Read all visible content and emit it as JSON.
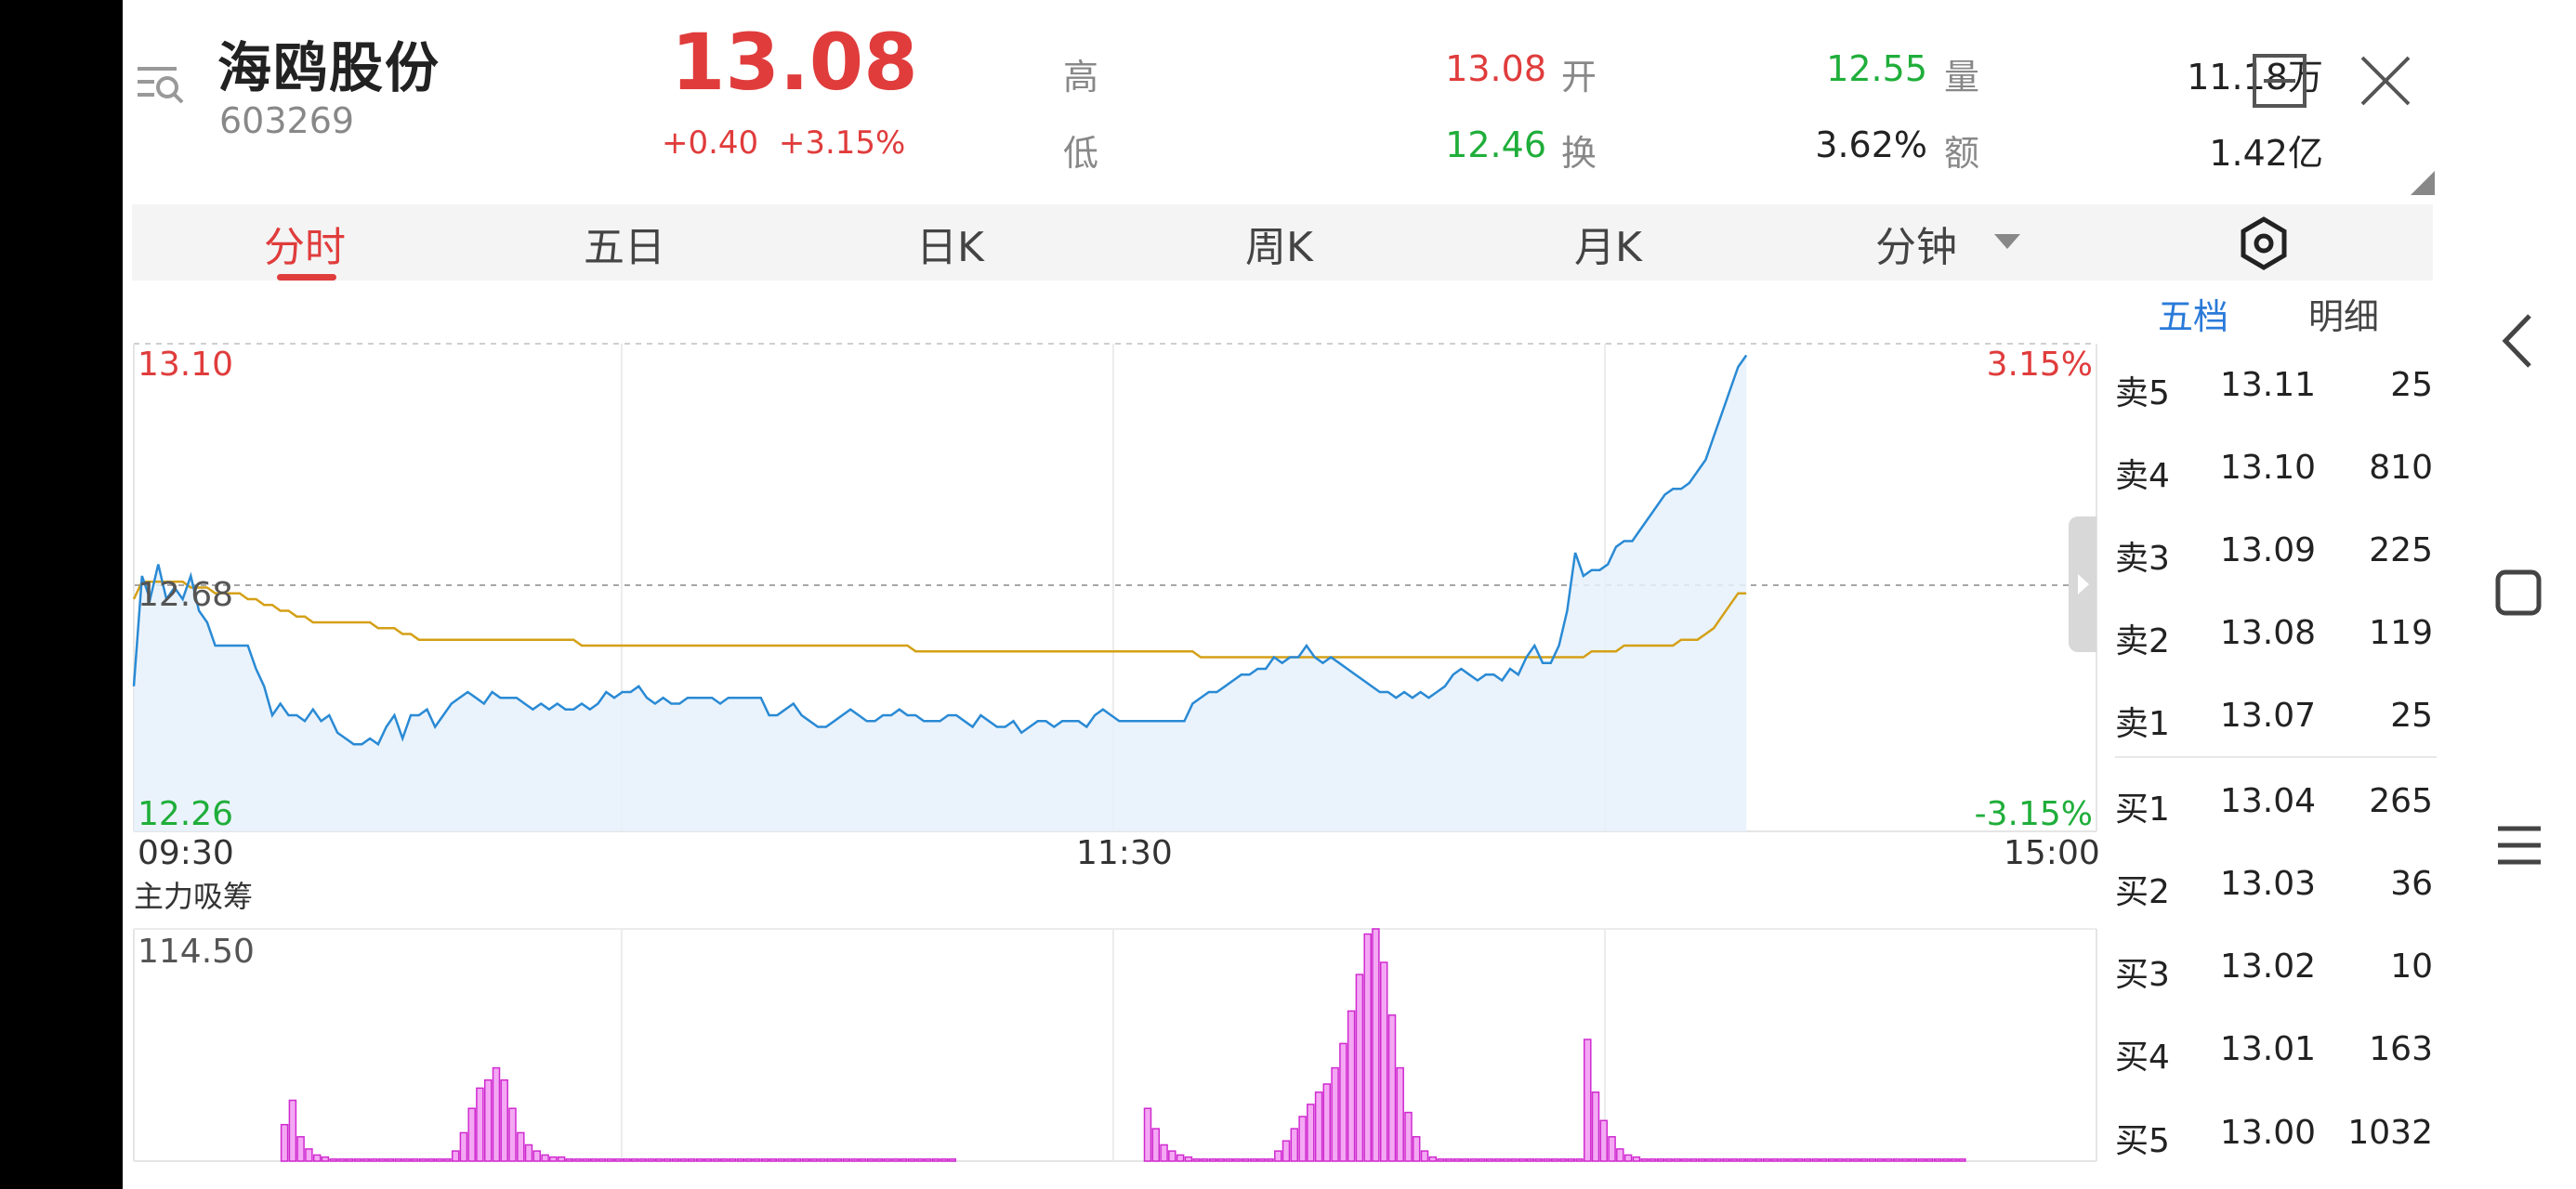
{
  "stock": {
    "name": "海鸥股份",
    "code": "603269",
    "price": "13.08",
    "change": "+0.40",
    "change_pct": "+3.15%"
  },
  "stats": {
    "high_label": "高",
    "high": "13.08",
    "open_label": "开",
    "open": "12.55",
    "volume_label": "量",
    "volume": "11.18万",
    "low_label": "低",
    "low": "12.46",
    "turnover_label": "换",
    "turnover": "3.62%",
    "amount_label": "额",
    "amount": "1.42亿"
  },
  "tabs": [
    "分时",
    "五日",
    "日K",
    "周K",
    "月K",
    "分钟"
  ],
  "active_tab": "分时",
  "orderbook": {
    "tabs": [
      "五档",
      "明细"
    ],
    "asks": [
      {
        "label": "卖5",
        "price": "13.11",
        "volume": "25"
      },
      {
        "label": "卖4",
        "price": "13.10",
        "volume": "810"
      },
      {
        "label": "卖3",
        "price": "13.09",
        "volume": "225"
      },
      {
        "label": "卖2",
        "price": "13.08",
        "volume": "119"
      },
      {
        "label": "卖1",
        "price": "13.07",
        "volume": "25"
      }
    ],
    "bids": [
      {
        "label": "买1",
        "price": "13.04",
        "volume": "265"
      },
      {
        "label": "买2",
        "price": "13.03",
        "volume": "36"
      },
      {
        "label": "买3",
        "price": "13.02",
        "volume": "10"
      },
      {
        "label": "买4",
        "price": "13.01",
        "volume": "163"
      },
      {
        "label": "买5",
        "price": "13.00",
        "volume": "1032"
      }
    ]
  },
  "chart_data": [
    {
      "type": "line",
      "y_top_label": "13.10",
      "y_mid_label": "12.68",
      "y_bottom_label": "12.26",
      "pct_top_label": "3.15%",
      "pct_bottom_label": "-3.15%",
      "x_labels": [
        "09:30",
        "11:30",
        "15:00"
      ],
      "ylim": [
        12.26,
        13.1
      ],
      "prev_close": 12.68,
      "series": [
        {
          "values": [
            12.51,
            12.7,
            12.66,
            12.72,
            12.66,
            12.68,
            12.66,
            12.7,
            12.64,
            12.62,
            12.58,
            12.58,
            12.58,
            12.58,
            12.58,
            12.54,
            12.51,
            12.46,
            12.48,
            12.46,
            12.46,
            12.45,
            12.47,
            12.45,
            12.46,
            12.43,
            12.42,
            12.41,
            12.41,
            12.42,
            12.41,
            12.44,
            12.46,
            12.42,
            12.46,
            12.46,
            12.47,
            12.44,
            12.46,
            12.48,
            12.49,
            12.5,
            12.49,
            12.48,
            12.5,
            12.49,
            12.49,
            12.49,
            12.48,
            12.47,
            12.48,
            12.47,
            12.48,
            12.47,
            12.47,
            12.48,
            12.47,
            12.48,
            12.5,
            12.49,
            12.5,
            12.5,
            12.51,
            12.49,
            12.48,
            12.49,
            12.48,
            12.48,
            12.49,
            12.49,
            12.49,
            12.49,
            12.48,
            12.49,
            12.49,
            12.49,
            12.49,
            12.49,
            12.46,
            12.46,
            12.47,
            12.48,
            12.46,
            12.45,
            12.44,
            12.44,
            12.45,
            12.46,
            12.47,
            12.46,
            12.45,
            12.45,
            12.46,
            12.46,
            12.47,
            12.46,
            12.46,
            12.45,
            12.45,
            12.45,
            12.46,
            12.46,
            12.45,
            12.44,
            12.46,
            12.45,
            12.44,
            12.44,
            12.45,
            12.43,
            12.44,
            12.45,
            12.45,
            12.44,
            12.45,
            12.45,
            12.45,
            12.44,
            12.46,
            12.47,
            12.46,
            12.45,
            12.45,
            12.45,
            12.45,
            12.45,
            12.45,
            12.45,
            12.45,
            12.45,
            12.48,
            12.49,
            12.5,
            12.5,
            12.51,
            12.52,
            12.53,
            12.53,
            12.54,
            12.54,
            12.56,
            12.55,
            12.56,
            12.56,
            12.58,
            12.56,
            12.55,
            12.56,
            12.55,
            12.54,
            12.53,
            12.52,
            12.51,
            12.5,
            12.5,
            12.49,
            12.5,
            12.49,
            12.5,
            12.49,
            12.5,
            12.51,
            12.53,
            12.54,
            12.53,
            12.52,
            12.53,
            12.53,
            12.52,
            12.54,
            12.53,
            12.56,
            12.58,
            12.55,
            12.55,
            12.58,
            12.64,
            12.74,
            12.7,
            12.71,
            12.71,
            12.72,
            12.75,
            12.76,
            12.76,
            12.78,
            12.8,
            12.82,
            12.84,
            12.85,
            12.85,
            12.86,
            12.88,
            12.9,
            12.94,
            12.98,
            13.02,
            13.06,
            13.08
          ]
        },
        {
          "values": [
            12.66,
            12.69,
            12.69,
            12.69,
            12.69,
            12.69,
            12.69,
            12.68,
            12.68,
            12.68,
            12.67,
            12.67,
            12.67,
            12.67,
            12.66,
            12.66,
            12.65,
            12.65,
            12.64,
            12.64,
            12.63,
            12.63,
            12.62,
            12.62,
            12.62,
            12.62,
            12.62,
            12.62,
            12.62,
            12.62,
            12.61,
            12.61,
            12.61,
            12.6,
            12.6,
            12.59,
            12.59,
            12.59,
            12.59,
            12.59,
            12.59,
            12.59,
            12.59,
            12.59,
            12.59,
            12.59,
            12.59,
            12.59,
            12.59,
            12.59,
            12.59,
            12.59,
            12.59,
            12.59,
            12.59,
            12.58,
            12.58,
            12.58,
            12.58,
            12.58,
            12.58,
            12.58,
            12.58,
            12.58,
            12.58,
            12.58,
            12.58,
            12.58,
            12.58,
            12.58,
            12.58,
            12.58,
            12.58,
            12.58,
            12.58,
            12.58,
            12.58,
            12.58,
            12.58,
            12.58,
            12.58,
            12.58,
            12.58,
            12.58,
            12.58,
            12.58,
            12.58,
            12.58,
            12.58,
            12.58,
            12.58,
            12.58,
            12.58,
            12.58,
            12.58,
            12.58,
            12.57,
            12.57,
            12.57,
            12.57,
            12.57,
            12.57,
            12.57,
            12.57,
            12.57,
            12.57,
            12.57,
            12.57,
            12.57,
            12.57,
            12.57,
            12.57,
            12.57,
            12.57,
            12.57,
            12.57,
            12.57,
            12.57,
            12.57,
            12.57,
            12.57,
            12.57,
            12.57,
            12.57,
            12.57,
            12.57,
            12.57,
            12.57,
            12.57,
            12.57,
            12.57,
            12.56,
            12.56,
            12.56,
            12.56,
            12.56,
            12.56,
            12.56,
            12.56,
            12.56,
            12.56,
            12.56,
            12.56,
            12.56,
            12.56,
            12.56,
            12.56,
            12.56,
            12.56,
            12.56,
            12.56,
            12.56,
            12.56,
            12.56,
            12.56,
            12.56,
            12.56,
            12.56,
            12.56,
            12.56,
            12.56,
            12.56,
            12.56,
            12.56,
            12.56,
            12.56,
            12.56,
            12.56,
            12.56,
            12.56,
            12.56,
            12.56,
            12.56,
            12.56,
            12.56,
            12.56,
            12.56,
            12.56,
            12.56,
            12.57,
            12.57,
            12.57,
            12.57,
            12.58,
            12.58,
            12.58,
            12.58,
            12.58,
            12.58,
            12.58,
            12.59,
            12.59,
            12.59,
            12.6,
            12.61,
            12.63,
            12.65,
            12.67,
            12.67
          ]
        }
      ]
    },
    {
      "type": "bar",
      "title": "主力吸筹",
      "y_max_label": "114.50",
      "ylim": [
        0,
        114.5
      ],
      "values": [
        0,
        0,
        0,
        0,
        0,
        0,
        0,
        0,
        0,
        0,
        0,
        0,
        0,
        0,
        0,
        0,
        0,
        0,
        18,
        30,
        12,
        6,
        3,
        2,
        1,
        1,
        1,
        1,
        1,
        1,
        1,
        1,
        1,
        1,
        1,
        1,
        1,
        1,
        1,
        5,
        14,
        26,
        36,
        40,
        46,
        40,
        26,
        14,
        8,
        5,
        3,
        2,
        2,
        1,
        1,
        1,
        1,
        1,
        1,
        1,
        1,
        1,
        1,
        1,
        1,
        1,
        1,
        1,
        1,
        1,
        1,
        1,
        1,
        1,
        1,
        1,
        1,
        1,
        1,
        1,
        1,
        1,
        1,
        1,
        1,
        1,
        1,
        1,
        1,
        1,
        1,
        1,
        1,
        1,
        1,
        1,
        1,
        1,
        1,
        1,
        1,
        0,
        0,
        0,
        0,
        0,
        0,
        0,
        0,
        0,
        0,
        0,
        0,
        0,
        0,
        0,
        0,
        0,
        0,
        0,
        0,
        0,
        0,
        0,
        26,
        16,
        8,
        5,
        3,
        2,
        1,
        1,
        1,
        1,
        1,
        1,
        1,
        1,
        1,
        1,
        5,
        10,
        16,
        22,
        28,
        34,
        38,
        46,
        58,
        74,
        92,
        112,
        114.5,
        98,
        72,
        46,
        24,
        12,
        5,
        2,
        1,
        1,
        1,
        1,
        1,
        1,
        1,
        1,
        1,
        1,
        1,
        1,
        1,
        1,
        1,
        1,
        1,
        1,
        60,
        34,
        20,
        12,
        6,
        3,
        2,
        1,
        1,
        1,
        1,
        1,
        1,
        1,
        1,
        1,
        1,
        1,
        1,
        1,
        1,
        1,
        1,
        1,
        1,
        1,
        1,
        1,
        1,
        1,
        1,
        1,
        1,
        1,
        1,
        1,
        1,
        1,
        1,
        1,
        1,
        1,
        1,
        1,
        1,
        1,
        1
      ]
    }
  ]
}
